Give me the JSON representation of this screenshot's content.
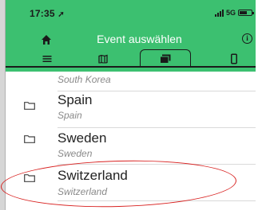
{
  "status_bar": {
    "time": "17:35",
    "network": "5G"
  },
  "header": {
    "title": "Event auswählen"
  },
  "tabs": [
    {
      "icon": "list-icon",
      "selected": false
    },
    {
      "icon": "map-icon",
      "selected": false
    },
    {
      "icon": "folder-icon",
      "selected": true
    },
    {
      "icon": "phone-icon",
      "selected": false
    }
  ],
  "list": {
    "partial_item": {
      "subtitle": "South Korea"
    },
    "items": [
      {
        "name": "Spain",
        "subtitle": "Spain"
      },
      {
        "name": "Sweden",
        "subtitle": "Sweden"
      },
      {
        "name": "Switzerland",
        "subtitle": "Switzerland"
      }
    ]
  },
  "colors": {
    "header_bg": "#3cc070",
    "highlight": "#d8201f"
  }
}
